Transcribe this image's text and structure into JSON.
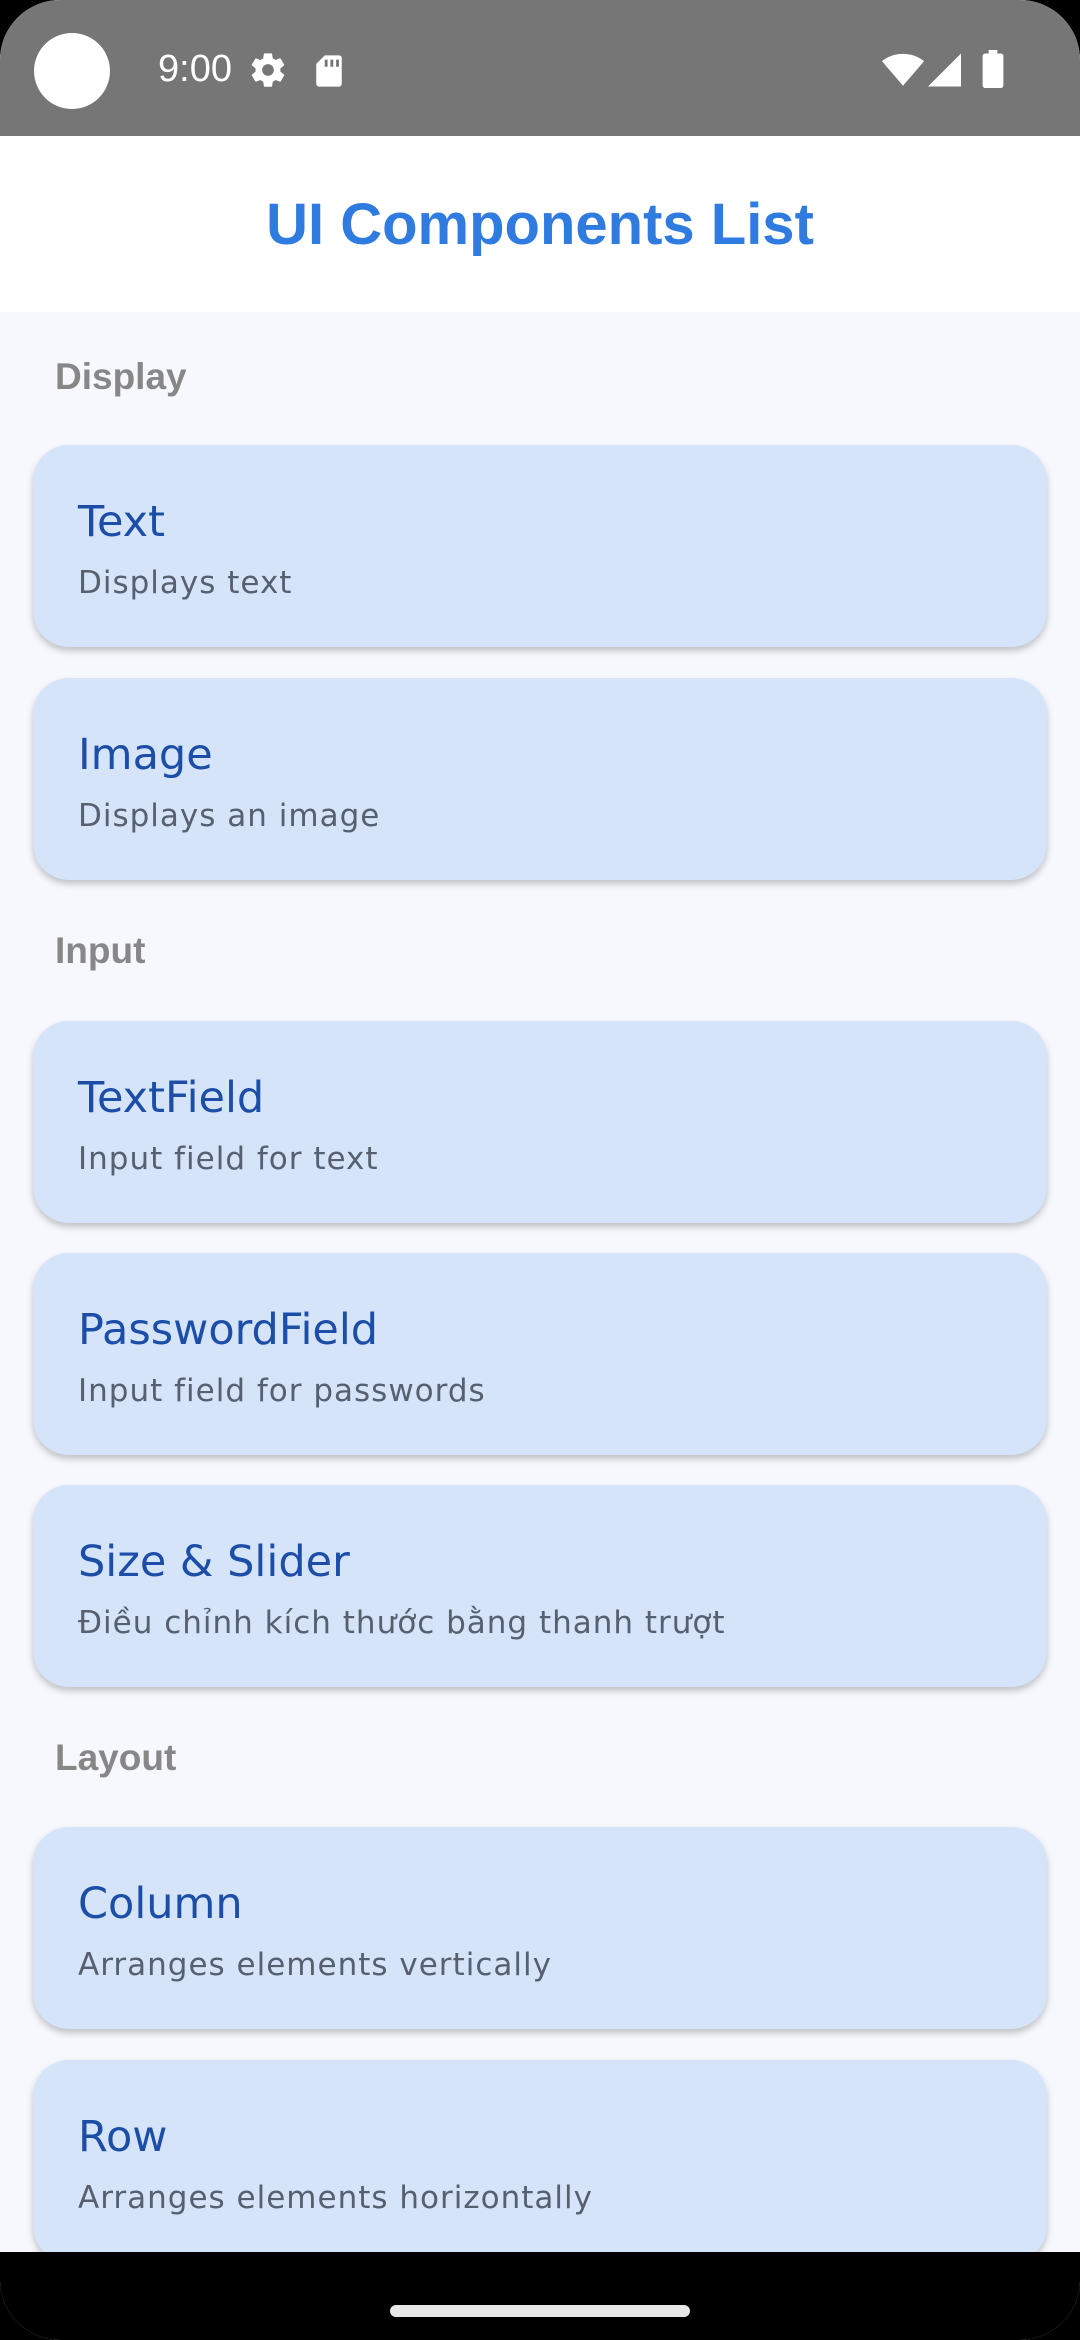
{
  "status_bar": {
    "time": "9:00",
    "icons": [
      "gear-icon",
      "sd-card-icon",
      "wifi-icon",
      "signal-icon",
      "battery-icon"
    ]
  },
  "app_bar": {
    "title": "UI Components List"
  },
  "sections": [
    {
      "header": "Display",
      "items": [
        {
          "title": "Text",
          "subtitle": "Displays text"
        },
        {
          "title": "Image",
          "subtitle": "Displays an image"
        }
      ]
    },
    {
      "header": "Input",
      "items": [
        {
          "title": "TextField",
          "subtitle": "Input field for text"
        },
        {
          "title": "PasswordField",
          "subtitle": "Input field for passwords"
        },
        {
          "title": "Size & Slider",
          "subtitle": "Điều chỉnh kích thước bằng thanh trượt"
        }
      ]
    },
    {
      "header": "Layout",
      "items": [
        {
          "title": "Column",
          "subtitle": "Arranges elements vertically"
        },
        {
          "title": "Row",
          "subtitle": "Arranges elements horizontally"
        }
      ]
    }
  ],
  "colors": {
    "accent": "#2f7be0",
    "card_bg": "#d6e4fa",
    "card_title": "#1c4ea8",
    "status_bar": "#767676",
    "page_bg": "#f6f8fd"
  }
}
